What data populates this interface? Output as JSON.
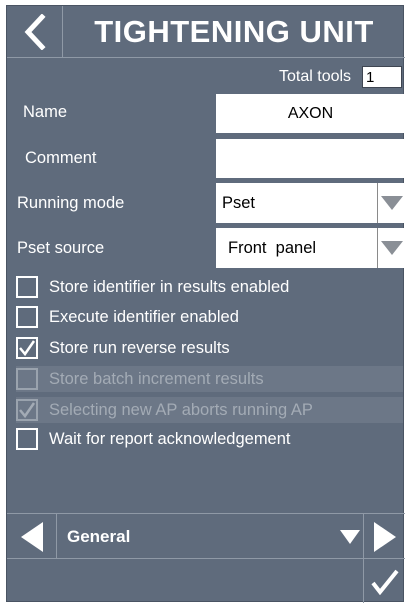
{
  "header": {
    "title": "TIGHTENING UNIT",
    "back_icon": "chevron-left-icon"
  },
  "total_tools": {
    "label": "Total tools",
    "value": "1"
  },
  "form": {
    "name": {
      "label": "Name",
      "value": "AXON"
    },
    "comment": {
      "label": "Comment",
      "value": ""
    },
    "running_mode": {
      "label": "Running mode",
      "value": "Pset"
    },
    "pset_source": {
      "label": "Pset source",
      "value": "Front  panel"
    }
  },
  "checkboxes": [
    {
      "label": "Store identifier in results enabled",
      "checked": false,
      "enabled": true
    },
    {
      "label": "Execute identifier enabled",
      "checked": false,
      "enabled": true
    },
    {
      "label": "Store run reverse results",
      "checked": true,
      "enabled": true
    },
    {
      "label": "Store batch increment results",
      "checked": false,
      "enabled": false
    },
    {
      "label": "Selecting new AP aborts running AP",
      "checked": true,
      "enabled": false
    },
    {
      "label": "Wait for report acknowledgement",
      "checked": false,
      "enabled": true
    }
  ],
  "nav": {
    "section": "General",
    "prev_icon": "triangle-left-icon",
    "next_icon": "triangle-right-icon",
    "dropdown_icon": "triangle-down-icon"
  },
  "footer": {
    "confirm_icon": "checkmark-icon"
  },
  "colors": {
    "panel": "#5f6b7c",
    "divider": "#8f99a6",
    "disabled_row": "#6c7787",
    "text": "#ffffff"
  }
}
